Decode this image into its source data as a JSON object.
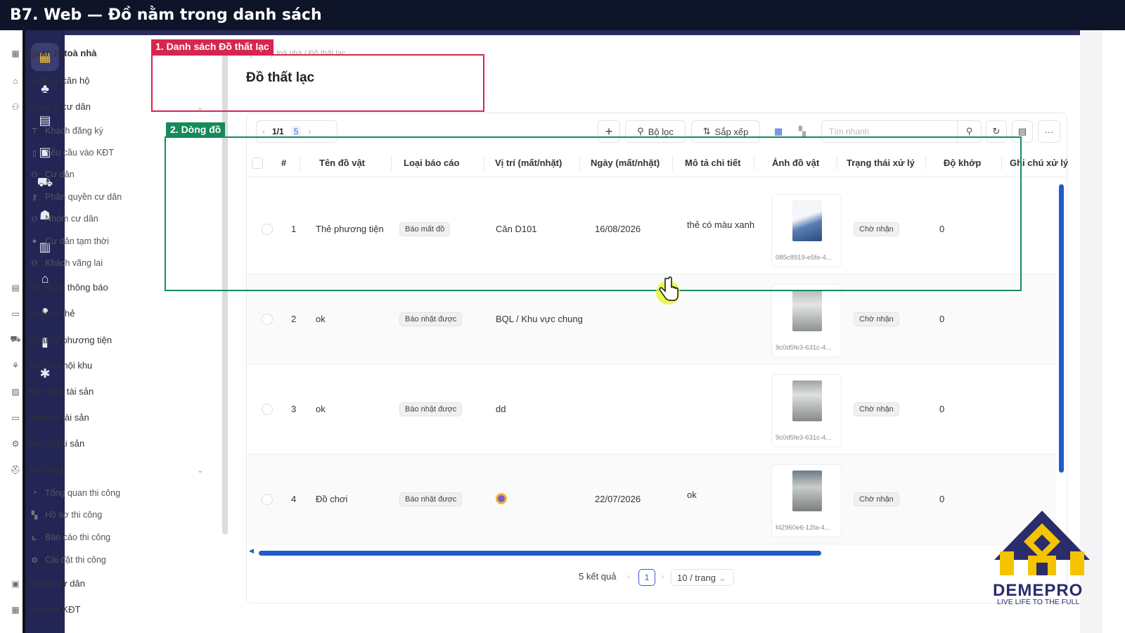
{
  "slide_title": "B7. Web — Đồ nằm trong danh sách",
  "annotations": {
    "box1_label": "1. Danh sách Đồ thất lạc",
    "box2_label": "2. Dòng đồ"
  },
  "sidebar": {
    "items": [
      {
        "label": "Quản lý toà nhà",
        "icon": "building-icon"
      },
      {
        "label": "Quản lý căn hộ",
        "icon": "home-icon"
      },
      {
        "label": "Quản lý cư dân",
        "icon": "residents-icon"
      },
      {
        "label": "Khách đăng ký",
        "icon": "guest-register-icon"
      },
      {
        "label": "Yêu cầu vào KĐT",
        "icon": "phone-icon"
      },
      {
        "label": "Cư dân",
        "icon": "resident-icon"
      },
      {
        "label": "Phân quyền cư dân",
        "icon": "key-icon"
      },
      {
        "label": "Nhóm cư dân",
        "icon": "group-icon"
      },
      {
        "label": "Cư dân tạm thời",
        "icon": "user-icon"
      },
      {
        "label": "Khách vãng lai",
        "icon": "visitor-icon"
      },
      {
        "label": "Tin tức & thông báo",
        "icon": "news-icon"
      },
      {
        "label": "Quản lý thẻ",
        "icon": "card-icon"
      },
      {
        "label": "Quản lý phương tiện",
        "icon": "car-icon"
      },
      {
        "label": "Tiện ích nội khu",
        "icon": "amenity-icon"
      },
      {
        "label": "Bàn giao tài sản",
        "icon": "handover-icon"
      },
      {
        "label": "Quản lý tài sản",
        "icon": "asset-icon"
      },
      {
        "label": "Bảo trì tài sản",
        "icon": "maintenance-icon"
      },
      {
        "label": "Thi công",
        "icon": "construction-icon"
      },
      {
        "label": "Tổng quan thi công",
        "icon": "pie-icon"
      },
      {
        "label": "Hồ sơ thi công",
        "icon": "folder-icon"
      },
      {
        "label": "Báo cáo thi công",
        "icon": "chart-icon"
      },
      {
        "label": "Cài đặt thi công",
        "icon": "gear-icon"
      },
      {
        "label": "Sổ tay cư dân",
        "icon": "handbook-icon"
      },
      {
        "label": "Sự kiện KĐT",
        "icon": "calendar-icon"
      }
    ]
  },
  "breadcrumb": "Quản lý toà nhà / Đồ thất lạc",
  "page_title": "Đồ thất lạc",
  "toolbar": {
    "page_indicator": "1/1",
    "count": "5",
    "filter_label": "Bộ lọc",
    "sort_label": "Sắp xếp",
    "search_placeholder": "Tìm nhanh"
  },
  "table": {
    "headers": [
      "#",
      "Tên đồ vật",
      "Loại báo cáo",
      "Vị trí (mất/nhặt)",
      "Ngày (mất/nhặt)",
      "Mô tả chi tiết",
      "Ảnh đồ vật",
      "Trạng thái xử lý",
      "Độ khớp",
      "Ghi chú xử lý"
    ],
    "rows": [
      {
        "num": "1",
        "name": "Thẻ phương tiện",
        "type": "Báo mất đồ",
        "location": "Căn D101",
        "date": "16/08/2026",
        "desc": "thẻ có màu xanh",
        "img_caption": "085c8919-e5fe-4...",
        "status": "Chờ nhận",
        "match": "0"
      },
      {
        "num": "2",
        "name": "ok",
        "type": "Báo nhặt được",
        "location": "BQL / Khu vực chung",
        "date": "",
        "desc": "",
        "img_caption": "9c0d5fe3-631c-4...",
        "status": "Chờ nhận",
        "match": "0"
      },
      {
        "num": "3",
        "name": "ok",
        "type": "Báo nhặt được",
        "location": "dd",
        "date": "",
        "desc": "",
        "img_caption": "9c0d5fe3-631c-4...",
        "status": "Chờ nhận",
        "match": "0"
      },
      {
        "num": "4",
        "name": "Đồ chơi",
        "type": "Báo nhặt được",
        "location": "",
        "date": "22/07/2026",
        "desc": "ok",
        "img_caption": "f42960e6-12fa-4...",
        "status": "Chờ nhận",
        "match": "0"
      }
    ]
  },
  "footer": {
    "total": "5 kết quả",
    "current_page": "1",
    "per_page": "10 / trang"
  },
  "brand": {
    "name": "DEMEPRO",
    "tagline": "LIVE LIFE TO THE FULL"
  },
  "colors": {
    "rail": "#232555",
    "annotation_red": "#d7264d",
    "annotation_green": "#168a5a",
    "accent_blue": "#1f5cc9",
    "brand_gold": "#f5c400"
  }
}
